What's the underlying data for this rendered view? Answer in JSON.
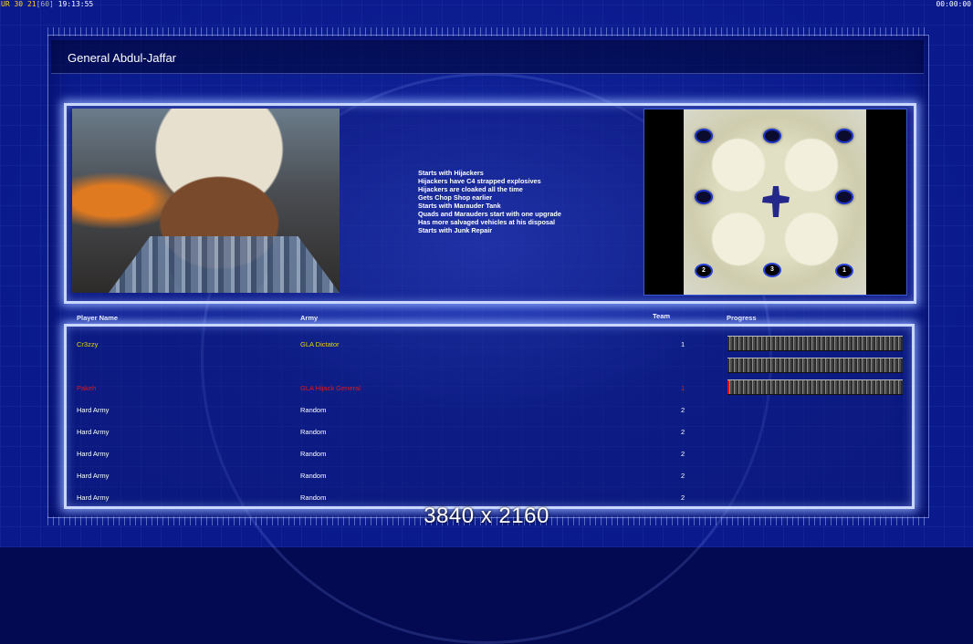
{
  "hud": {
    "left_prefix": "UR",
    "left_num1": "30",
    "left_num2": "21",
    "left_bracket": "[60]",
    "left_time": "19:13:55",
    "right_time": "00:00:00"
  },
  "general": {
    "name": "General Abdul-Jaffar",
    "traits": [
      "Starts with Hijackers",
      "Hijackers have C4 strapped explosives",
      "Hijackers are cloaked all the time",
      "Gets Chop Shop earlier",
      "Starts with Marauder Tank",
      "Quads and Marauders start with one upgrade",
      "Has more salvaged vehicles at his disposal",
      "Starts with Junk Repair"
    ]
  },
  "minimap": {
    "start_labels": [
      "2",
      "3",
      "1"
    ]
  },
  "table": {
    "headers": {
      "player": "Player Name",
      "army": "Army",
      "team": "Team",
      "progress": "Progress"
    },
    "rows": [
      {
        "name": "Cr3zzy",
        "army": "GLA Dictator",
        "team": "1",
        "color": "#e8d200",
        "progress": 0.0
      },
      {
        "name": "",
        "army": "",
        "team": "",
        "color": "#1b2fe0",
        "progress": 0.0
      },
      {
        "name": "Pakeh",
        "army": "GLA Hijack General",
        "team": "1",
        "color": "#e01818",
        "progress": 0.01
      },
      {
        "name": "Hard Army",
        "army": "Random",
        "team": "2",
        "color": "#ffffff"
      },
      {
        "name": "Hard Army",
        "army": "Random",
        "team": "2",
        "color": "#ffffff"
      },
      {
        "name": "Hard Army",
        "army": "Random",
        "team": "2",
        "color": "#ffffff"
      },
      {
        "name": "Hard Army",
        "army": "Random",
        "team": "2",
        "color": "#ffffff"
      },
      {
        "name": "Hard Army",
        "army": "Random",
        "team": "2",
        "color": "#ffffff"
      }
    ]
  },
  "overlay": {
    "resolution": "3840 x 2160"
  }
}
